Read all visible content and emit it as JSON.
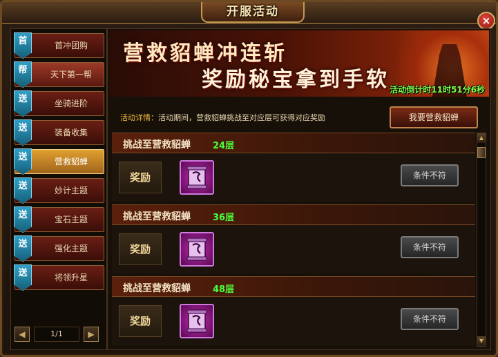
{
  "window": {
    "title": "开服活动",
    "close": "×"
  },
  "sidebar": {
    "items": [
      {
        "tag": "首",
        "label": "首冲团购"
      },
      {
        "tag": "帮",
        "label": "天下第一帮"
      },
      {
        "tag": "送",
        "label": "坐骑进阶"
      },
      {
        "tag": "送",
        "label": "装备收集"
      },
      {
        "tag": "送",
        "label": "营救貂蝉"
      },
      {
        "tag": "送",
        "label": "妙计主题"
      },
      {
        "tag": "送",
        "label": "宝石主题"
      },
      {
        "tag": "送",
        "label": "强化主题"
      },
      {
        "tag": "送",
        "label": "将领升星"
      }
    ],
    "active_index": 4,
    "pager": {
      "prev": "◀",
      "page": "1/1",
      "next": "▶"
    }
  },
  "banner": {
    "line1": "营救貂蝉冲连斩",
    "line2": "奖励秘宝拿到手软",
    "countdown": "活动倒计时11时51分6秒"
  },
  "detail": {
    "label": "活动详情：",
    "text": "活动期间，营救貂蝉挑战至对应层可获得对应奖励"
  },
  "action_button": "我要营救貂蝉",
  "rewards": [
    {
      "title": "挑战至营救貂蝉",
      "level": "24层",
      "reward_label": "奖励",
      "status": "条件不符"
    },
    {
      "title": "挑战至营救貂蝉",
      "level": "36层",
      "reward_label": "奖励",
      "status": "条件不符"
    },
    {
      "title": "挑战至营救貂蝉",
      "level": "48层",
      "reward_label": "奖励",
      "status": "条件不符"
    }
  ],
  "scrollbar": {
    "up": "▲",
    "down": "▼"
  },
  "colors": {
    "accent_gold": "#f0b83a",
    "level_green": "#4aff3a",
    "countdown_green": "#7cff4a",
    "item_purple": "#c42ab4"
  },
  "icons": {
    "close": "close-icon",
    "reward_item": "scroll-item-icon",
    "prev": "arrow-left-icon",
    "next": "arrow-right-icon"
  }
}
